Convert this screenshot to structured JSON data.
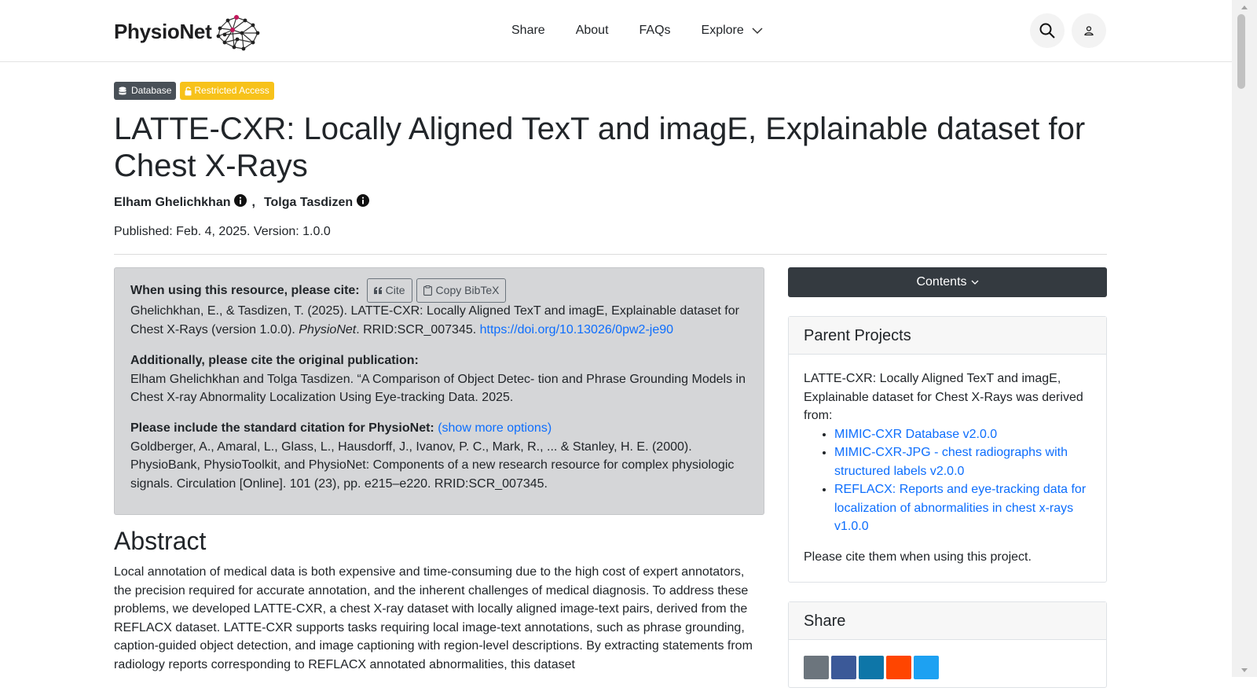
{
  "header": {
    "logo_text": "PhysioNet",
    "nav": [
      {
        "label": "Share"
      },
      {
        "label": "About"
      },
      {
        "label": "FAQs"
      },
      {
        "label": "Explore"
      }
    ]
  },
  "badges": {
    "database": "Database",
    "restricted": "Restricted Access"
  },
  "project": {
    "title": "LATTE-CXR: Locally Aligned TexT and imagE, Explainable dataset for Chest X-Rays",
    "authors": [
      {
        "name": "Elham Ghelichkhan",
        "sep": ","
      },
      {
        "name": "Tolga Tasdizen",
        "sep": ""
      }
    ],
    "published": "Published: Feb. 4, 2025. Version: 1.0.0"
  },
  "citation": {
    "heading": "When using this resource, please cite:",
    "cite_button": "Cite",
    "bibtex_button": "Copy BibTeX",
    "text_pre": "Ghelichkhan, E., & Tasdizen, T. (2025). LATTE-CXR: Locally Aligned TexT and imagE, Explainable dataset for Chest X-Rays (version 1.0.0). ",
    "journal": "PhysioNet",
    "text_rrid": ". RRID:SCR_007345. ",
    "doi": "https://doi.org/10.13026/0pw2-je90",
    "original_heading": "Additionally, please cite the original publication:",
    "original_text": "Elham Ghelichkhan and Tolga Tasdizen. “A Comparison of Object Detec- tion and Phrase Grounding Models in Chest X-ray Abnormality Localization Using Eye-tracking Data. 2025.",
    "standard_heading": "Please include the standard citation for PhysioNet:",
    "show_more": "(show more options)",
    "standard_text": "Goldberger, A., Amaral, L., Glass, L., Hausdorff, J., Ivanov, P. C., Mark, R., ... & Stanley, H. E. (2000). PhysioBank, PhysioToolkit, and PhysioNet: Components of a new research resource for complex physiologic signals. Circulation [Online]. 101 (23), pp. e215–e220. RRID:SCR_007345."
  },
  "abstract": {
    "heading": "Abstract",
    "text": "Local annotation of medical data is both expensive and time-consuming due to the high cost of expert annotators, the precision required for accurate annotation, and the inherent challenges of medical diagnosis. To address these problems, we developed LATTE-CXR, a chest X-ray dataset with locally aligned image-text pairs, derived from the REFLACX dataset. LATTE-CXR supports tasks requiring local image-text annotations, such as phrase grounding, caption-guided object detection, and image captioning with region-level descriptions. By extracting statements from radiology reports corresponding to REFLACX annotated abnormalities, this dataset"
  },
  "sidebar": {
    "contents_label": "Contents",
    "parent_projects": {
      "heading": "Parent Projects",
      "intro": "LATTE-CXR: Locally Aligned TexT and imagE, Explainable dataset for Chest X-Rays was derived from:",
      "links": [
        {
          "label": "MIMIC-CXR Database v2.0.0"
        },
        {
          "label": "MIMIC-CXR-JPG - chest radiographs with structured labels v2.0.0"
        },
        {
          "label": "REFLACX: Reports and eye-tracking data for localization of abnormalities in chest x-rays v1.0.0"
        }
      ],
      "footer": "Please cite them when using this project."
    },
    "share": {
      "heading": "Share",
      "icons": [
        {
          "name": "email-share-icon",
          "color": "#6c757d"
        },
        {
          "name": "facebook-share-icon",
          "color": "#3b5998"
        },
        {
          "name": "linkedin-share-icon",
          "color": "#0e76a8"
        },
        {
          "name": "reddit-share-icon",
          "color": "#ff4500"
        },
        {
          "name": "twitter-share-icon",
          "color": "#1da1f2"
        }
      ]
    }
  }
}
